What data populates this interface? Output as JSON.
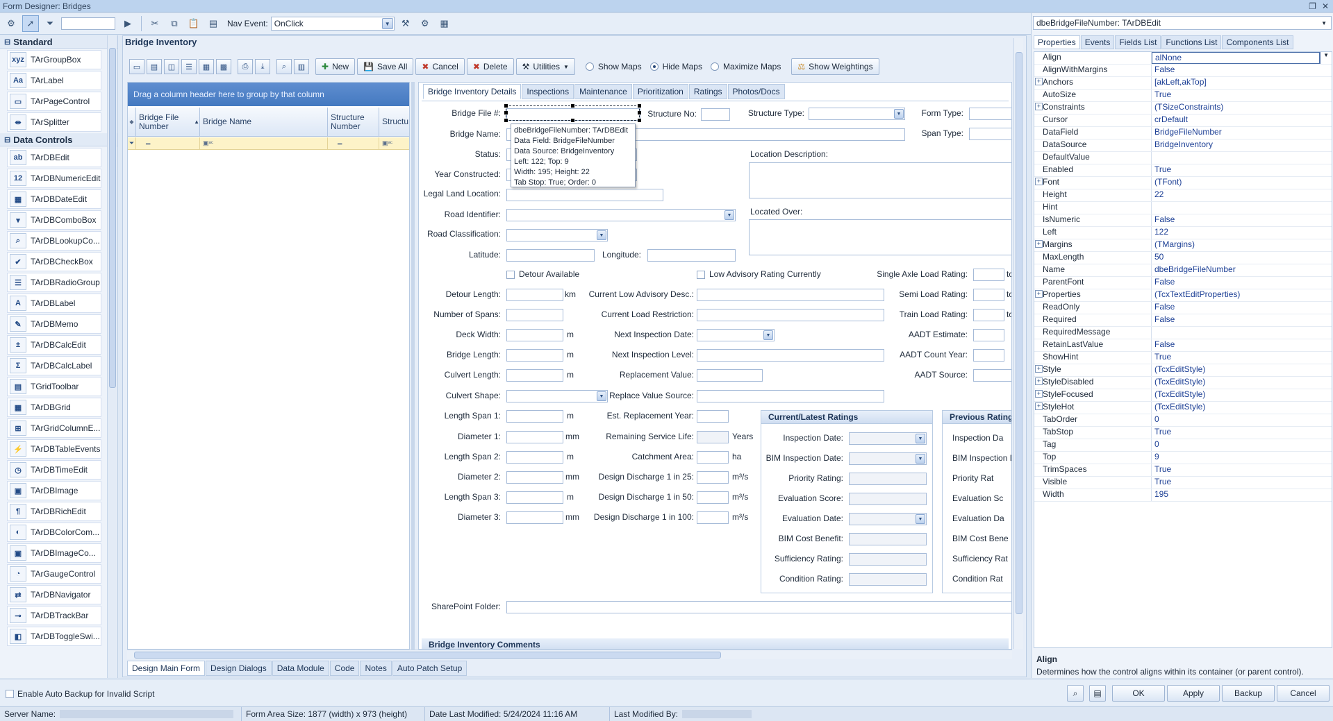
{
  "window": {
    "title": "Form Designer: Bridges"
  },
  "toolbar": {
    "nav_event_label": "Nav Event:",
    "nav_event_value": "OnClick"
  },
  "palette": {
    "sections": [
      {
        "title": "Standard",
        "items": [
          {
            "label": "TArGroupBox",
            "icon": "group-box-icon",
            "glyph": "xyz"
          },
          {
            "label": "TArLabel",
            "icon": "label-icon",
            "glyph": "Aa"
          },
          {
            "label": "TArPageControl",
            "icon": "page-control-icon",
            "glyph": "▭"
          },
          {
            "label": "TArSplitter",
            "icon": "splitter-icon",
            "glyph": "⇹"
          }
        ]
      },
      {
        "title": "Data Controls",
        "items": [
          {
            "label": "TArDBEdit",
            "icon": "edit-icon",
            "glyph": "ab"
          },
          {
            "label": "TArDBNumericEdit",
            "icon": "numeric-edit-icon",
            "glyph": "12"
          },
          {
            "label": "TArDBDateEdit",
            "icon": "date-edit-icon",
            "glyph": "▦"
          },
          {
            "label": "TArDBComboBox",
            "icon": "combo-box-icon",
            "glyph": "▾"
          },
          {
            "label": "TArDBLookupCo...",
            "icon": "lookup-combo-icon",
            "glyph": "⌕"
          },
          {
            "label": "TArDBCheckBox",
            "icon": "check-box-icon",
            "glyph": "✔"
          },
          {
            "label": "TArDBRadioGroup",
            "icon": "radio-group-icon",
            "glyph": "☰"
          },
          {
            "label": "TArDBLabel",
            "icon": "db-label-icon",
            "glyph": "A"
          },
          {
            "label": "TArDBMemo",
            "icon": "memo-icon",
            "glyph": "✎"
          },
          {
            "label": "TArDBCalcEdit",
            "icon": "calc-edit-icon",
            "glyph": "±"
          },
          {
            "label": "TArDBCalcLabel",
            "icon": "calc-label-icon",
            "glyph": "Σ"
          },
          {
            "label": "TGridToolbar",
            "icon": "grid-toolbar-icon",
            "glyph": "▤"
          },
          {
            "label": "TArDBGrid",
            "icon": "grid-icon",
            "glyph": "▦"
          },
          {
            "label": "TArGridColumnE...",
            "icon": "grid-column-icon",
            "glyph": "⊞"
          },
          {
            "label": "TArDBTableEvents",
            "icon": "table-events-icon",
            "glyph": "⚡"
          },
          {
            "label": "TArDBTimeEdit",
            "icon": "clock-icon",
            "glyph": "◷"
          },
          {
            "label": "TArDBImage",
            "icon": "image-icon",
            "glyph": "▣"
          },
          {
            "label": "TArDBRichEdit",
            "icon": "rich-edit-icon",
            "glyph": "¶"
          },
          {
            "label": "TArDBColorCom...",
            "icon": "color-combo-icon",
            "glyph": "◐"
          },
          {
            "label": "TArDBImageCo...",
            "icon": "image-combo-icon",
            "glyph": "▣"
          },
          {
            "label": "TArGaugeControl",
            "icon": "gauge-icon",
            "glyph": "◔"
          },
          {
            "label": "TArDBNavigator",
            "icon": "navigator-icon",
            "glyph": "⇄"
          },
          {
            "label": "TArDBTrackBar",
            "icon": "track-bar-icon",
            "glyph": "⊸"
          },
          {
            "label": "TArDBToggleSwi...",
            "icon": "toggle-switch-icon",
            "glyph": "◧"
          }
        ]
      }
    ]
  },
  "form": {
    "title": "Bridge Inventory",
    "buttons": {
      "new": "New",
      "save_all": "Save All",
      "cancel": "Cancel",
      "delete": "Delete",
      "utilities": "Utilities",
      "show_weightings": "Show Weightings"
    },
    "map_options": [
      {
        "label": "Show Maps",
        "selected": false
      },
      {
        "label": "Hide Maps",
        "selected": true
      },
      {
        "label": "Maximize Maps",
        "selected": false
      }
    ]
  },
  "grid": {
    "group_hint": "Drag a column header here to group by that column",
    "columns": [
      "Bridge File Number",
      "Bridge Name",
      "Structure Number",
      "Structu"
    ]
  },
  "tabs": [
    "Bridge Inventory Details",
    "Inspections",
    "Maintenance",
    "Prioritization",
    "Ratings",
    "Photos/Docs"
  ],
  "fields": {
    "bridge_file": "Bridge File #:",
    "structure_no": "Structure No:",
    "structure_type": "Structure Type:",
    "form_type": "Form Type:",
    "bridge_name": "Bridge Name:",
    "span_type": "Span Type:",
    "status": "Status:",
    "year_constructed": "Year Constructed:",
    "legal_land": "Legal Land Location:",
    "location_desc": "Location Description:",
    "located_over": "Located Over:",
    "road_identifier": "Road Identifier:",
    "road_classification": "Road Classification:",
    "latitude": "Latitude:",
    "longitude": "Longitude:",
    "detour_available": "Detour Available",
    "low_advisory": "Low Advisory Rating Currently",
    "single_axle": "Single Axle Load Rating:",
    "detour_length": "Detour Length:",
    "current_low_adv": "Current Low Advisory Desc.:",
    "semi_load": "Semi Load Rating:",
    "num_spans": "Number of Spans:",
    "current_load_restr": "Current Load Restriction:",
    "train_load": "Train Load Rating:",
    "deck_width": "Deck Width:",
    "next_insp_date": "Next Inspection Date:",
    "aadt_estimate": "AADT Estimate:",
    "bridge_length": "Bridge Length:",
    "next_insp_level": "Next Inspection Level:",
    "aadt_count_year": "AADT Count Year:",
    "culvert_length": "Culvert Length:",
    "replacement_value": "Replacement Value:",
    "aadt_source": "AADT Source:",
    "culvert_shape": "Culvert Shape:",
    "replace_value_source": "Replace Value Source:",
    "length_span_1": "Length Span 1:",
    "est_replacement_year": "Est. Replacement Year:",
    "diameter_1": "Diameter 1:",
    "remaining_service_life": "Remaining Service Life:",
    "length_span_2": "Length Span 2:",
    "catchment_area": "Catchment Area:",
    "diameter_2": "Diameter 2:",
    "design_discharge_25": "Design Discharge 1 in 25:",
    "length_span_3": "Length Span 3:",
    "design_discharge_50": "Design Discharge 1 in 50:",
    "diameter_3": "Diameter 3:",
    "design_discharge_100": "Design Discharge 1 in 100:",
    "sharepoint_folder": "SharePoint Folder:",
    "comments_section": "Bridge Inventory Comments"
  },
  "units": {
    "km": "km",
    "m": "m",
    "mm": "mm",
    "years": "Years",
    "ha": "ha",
    "m3s": "m³/s",
    "tc": "tc"
  },
  "ratings": {
    "current_title": "Current/Latest Ratings",
    "previous_title": "Previous Ratings",
    "labels": [
      "Inspection Date:",
      "BIM Inspection Date:",
      "Priority Rating:",
      "Evaluation Score:",
      "Evaluation Date:",
      "BIM Cost Benefit:",
      "Sufficiency Rating:",
      "Condition Rating:"
    ],
    "prev_labels": [
      "Inspection Da",
      "BIM Inspection Da",
      "Priority Rat",
      "Evaluation Sc",
      "Evaluation Da",
      "BIM Cost Bene",
      "Sufficiency Rat",
      "Condition Rat"
    ]
  },
  "tooltip": {
    "lines": [
      "dbeBridgeFileNumber: TArDBEdit",
      "Data Field: BridgeFileNumber",
      "Data Source: BridgeInventory",
      "Left: 122;  Top: 9",
      "Width: 195;  Height: 22",
      "Tab Stop: True;  Order: 0"
    ]
  },
  "bottom_tabs": [
    "Design Main Form",
    "Design Dialogs",
    "Data Module",
    "Code",
    "Notes",
    "Auto Patch Setup"
  ],
  "inspector": {
    "selected_component": "dbeBridgeFileNumber: TArDBEdit",
    "tabs": [
      "Properties",
      "Events",
      "Fields List",
      "Functions List",
      "Components List"
    ],
    "properties": [
      {
        "name": "Align",
        "value": "alNone",
        "expandable": false
      },
      {
        "name": "AlignWithMargins",
        "value": "False",
        "expandable": false
      },
      {
        "name": "Anchors",
        "value": "[akLeft,akTop]",
        "expandable": true
      },
      {
        "name": "AutoSize",
        "value": "True",
        "expandable": false
      },
      {
        "name": "Constraints",
        "value": "(TSizeConstraints)",
        "expandable": true
      },
      {
        "name": "Cursor",
        "value": "crDefault",
        "expandable": false
      },
      {
        "name": "DataField",
        "value": "BridgeFileNumber",
        "expandable": false
      },
      {
        "name": "DataSource",
        "value": "BridgeInventory",
        "expandable": false
      },
      {
        "name": "DefaultValue",
        "value": "",
        "expandable": false
      },
      {
        "name": "Enabled",
        "value": "True",
        "expandable": false
      },
      {
        "name": "Font",
        "value": "(TFont)",
        "expandable": true
      },
      {
        "name": "Height",
        "value": "22",
        "expandable": false
      },
      {
        "name": "Hint",
        "value": "",
        "expandable": false
      },
      {
        "name": "IsNumeric",
        "value": "False",
        "expandable": false
      },
      {
        "name": "Left",
        "value": "122",
        "expandable": false
      },
      {
        "name": "Margins",
        "value": "(TMargins)",
        "expandable": true
      },
      {
        "name": "MaxLength",
        "value": "50",
        "expandable": false
      },
      {
        "name": "Name",
        "value": "dbeBridgeFileNumber",
        "expandable": false
      },
      {
        "name": "ParentFont",
        "value": "False",
        "expandable": false
      },
      {
        "name": "Properties",
        "value": "(TcxTextEditProperties)",
        "expandable": true
      },
      {
        "name": "ReadOnly",
        "value": "False",
        "expandable": false
      },
      {
        "name": "Required",
        "value": "False",
        "expandable": false
      },
      {
        "name": "RequiredMessage",
        "value": "",
        "expandable": false
      },
      {
        "name": "RetainLastValue",
        "value": "False",
        "expandable": false
      },
      {
        "name": "ShowHint",
        "value": "True",
        "expandable": false
      },
      {
        "name": "Style",
        "value": "(TcxEditStyle)",
        "expandable": true
      },
      {
        "name": "StyleDisabled",
        "value": "(TcxEditStyle)",
        "expandable": true
      },
      {
        "name": "StyleFocused",
        "value": "(TcxEditStyle)",
        "expandable": true
      },
      {
        "name": "StyleHot",
        "value": "(TcxEditStyle)",
        "expandable": true
      },
      {
        "name": "TabOrder",
        "value": "0",
        "expandable": false
      },
      {
        "name": "TabStop",
        "value": "True",
        "expandable": false
      },
      {
        "name": "Tag",
        "value": "0",
        "expandable": false
      },
      {
        "name": "Top",
        "value": "9",
        "expandable": false
      },
      {
        "name": "TrimSpaces",
        "value": "True",
        "expandable": false
      },
      {
        "name": "Visible",
        "value": "True",
        "expandable": false
      },
      {
        "name": "Width",
        "value": "195",
        "expandable": false
      }
    ],
    "desc_title": "Align",
    "desc_text": "Determines how the control aligns within its container (or parent control)."
  },
  "footer": {
    "auto_backup": "Enable Auto Backup for Invalid Script",
    "buttons": {
      "ok": "OK",
      "apply": "Apply",
      "backup": "Backup",
      "cancel": "Cancel"
    }
  },
  "status": {
    "server_name": "Server Name:",
    "form_area": "Form Area Size: 1877 (width) x 973 (height)",
    "date_modified": "Date Last Modified: 5/24/2024 11:16 AM",
    "last_modified_by": "Last Modified By:"
  }
}
